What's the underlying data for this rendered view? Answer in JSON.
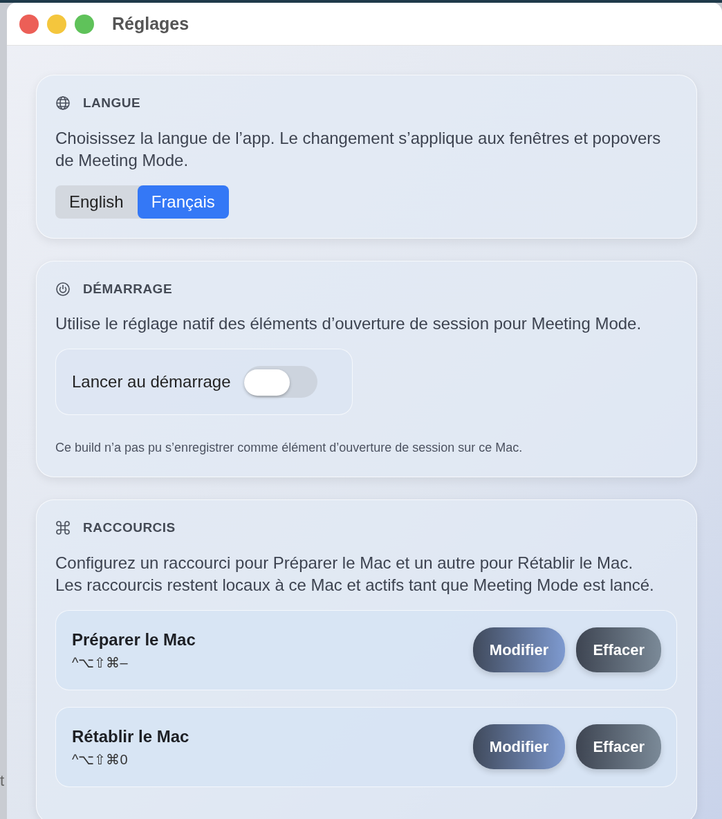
{
  "window": {
    "title": "Réglages"
  },
  "background_text": "t",
  "sections": [
    {
      "kind": "language",
      "title": "LANGUE",
      "description": "Choisissez la langue de l’app. Le changement s’applique aux fenêtres et popovers de Meeting Mode.",
      "options": [
        {
          "label": "English",
          "selected": false
        },
        {
          "label": "Français",
          "selected": true
        }
      ]
    },
    {
      "kind": "startup",
      "title": "DÉMARRAGE",
      "description": "Utilise le réglage natif des éléments d’ouverture de session pour Meeting Mode.",
      "toggle": {
        "label": "Lancer au démarrage",
        "on": false
      },
      "note": "Ce build n’a pas pu s’enregistrer comme élément d’ouverture de session sur ce Mac."
    },
    {
      "kind": "shortcuts",
      "title": "RACCOURCIS",
      "description": "Configurez un raccourci pour Préparer le Mac et un autre pour Rétablir le Mac. Les raccourcis restent locaux à ce Mac et actifs tant que Meeting Mode est lancé.",
      "shortcuts": [
        {
          "name": "Préparer le Mac",
          "keys": "^⌥⇧⌘–",
          "buttons": [
            "Modifier",
            "Effacer"
          ]
        },
        {
          "name": "Rétablir le Mac",
          "keys": "^⌥⇧⌘0",
          "buttons": [
            "Modifier",
            "Effacer"
          ]
        }
      ]
    }
  ]
}
